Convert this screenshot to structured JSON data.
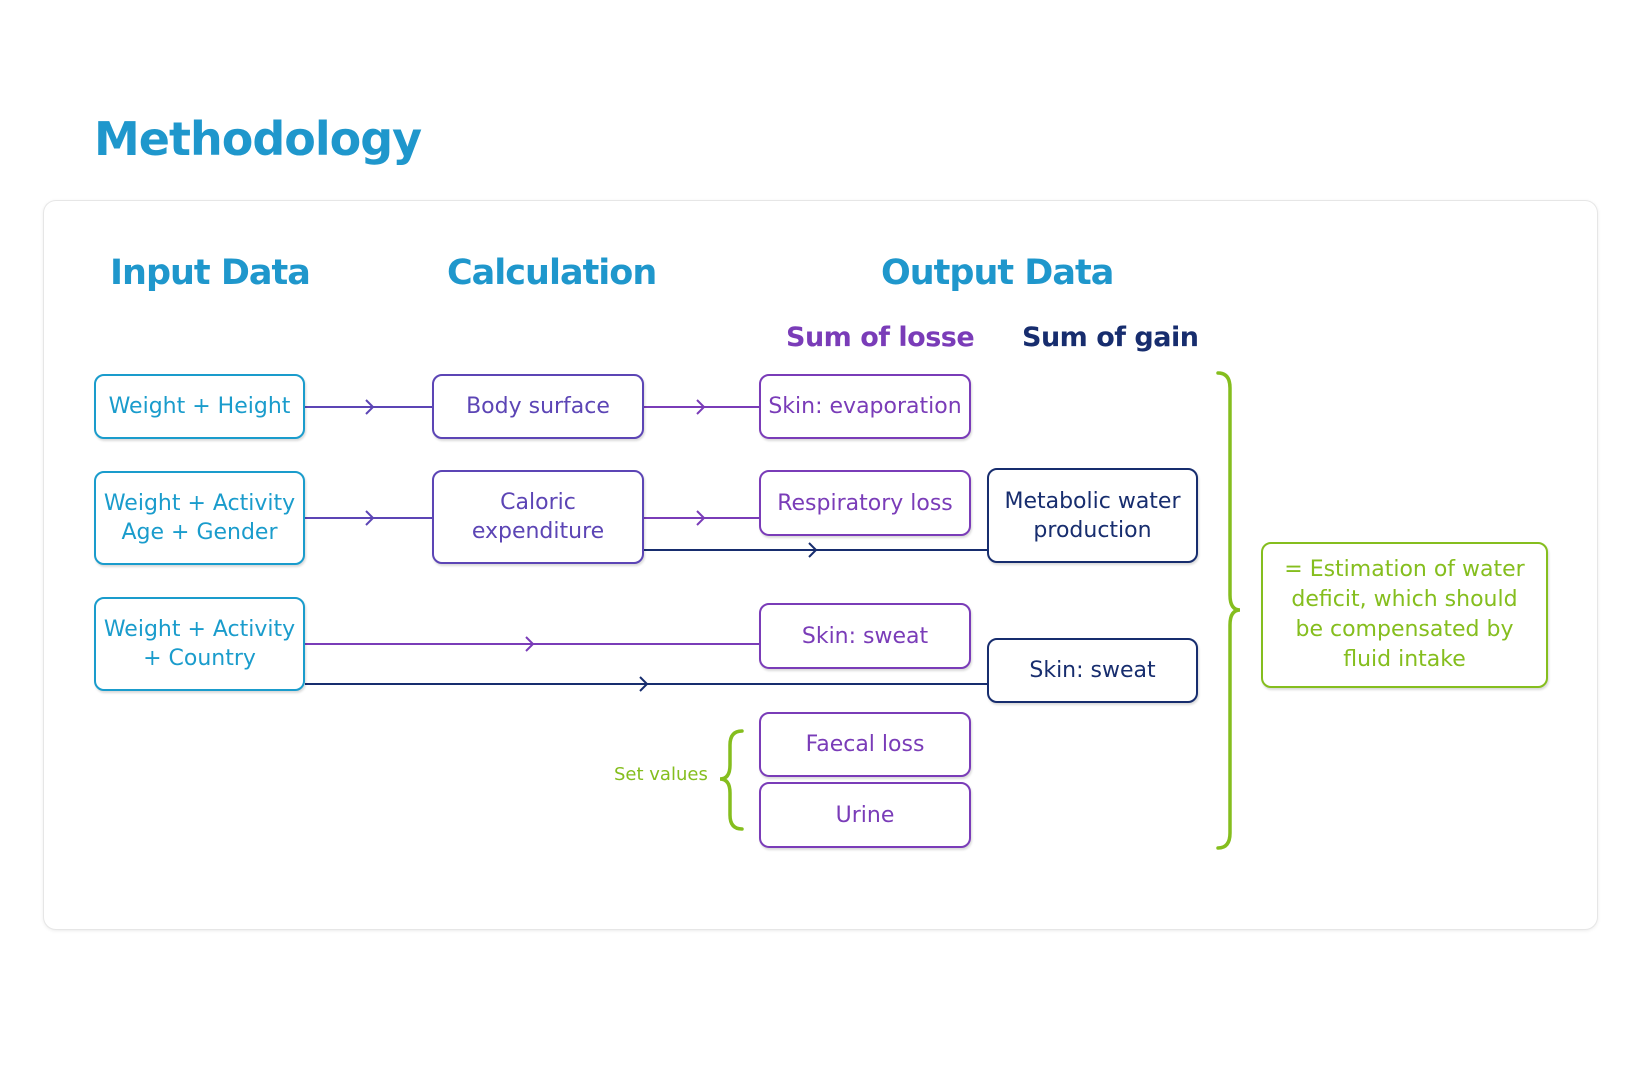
{
  "page": {
    "title": "Methodology"
  },
  "columns": {
    "input": "Input Data",
    "calculation": "Calculation",
    "output": "Output Data",
    "losses": "Sum of losse",
    "gains": "Sum of gain"
  },
  "inputs": [
    {
      "label": "Weight + Height"
    },
    {
      "label": "Weight + Activity\nAge + Gender"
    },
    {
      "label": "Weight + Activity\n+ Country"
    }
  ],
  "calculations": [
    {
      "label": "Body surface"
    },
    {
      "label": "Caloric\nexpenditure"
    }
  ],
  "losses": [
    {
      "label": "Skin: evaporation"
    },
    {
      "label": "Respiratory loss"
    },
    {
      "label": "Skin: sweat"
    },
    {
      "label": "Faecal loss"
    },
    {
      "label": "Urine"
    }
  ],
  "gains": [
    {
      "label": "Metabolic water\nproduction"
    },
    {
      "label": "Skin: sweat"
    }
  ],
  "set_values_label": "Set values",
  "result": {
    "label": "= Estimation of water\ndeficit, which should\nbe compensated by\nfluid intake"
  },
  "colors": {
    "input": "#1a9ccc",
    "calculation": "#5c45b5",
    "loss": "#7a3cb8",
    "gain": "#172d6e",
    "result": "#85be1e",
    "title": "#1f97cc"
  }
}
